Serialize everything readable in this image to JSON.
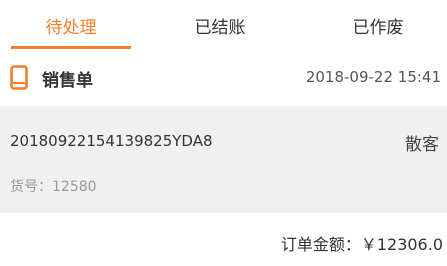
{
  "tabs": [
    {
      "label": "待处理",
      "active": true
    },
    {
      "label": "已结账",
      "active": false
    },
    {
      "label": "已作废",
      "active": false
    }
  ],
  "accent_color": "#f47e2a",
  "order": {
    "icon": "phone-icon",
    "type_label": "销售单",
    "time": "2018-09-22 15:41",
    "order_number": "20180922154139825YDA8",
    "customer": "散客",
    "item_number_text": "货号：12580",
    "total_text": "订单金额：￥12306.0"
  }
}
